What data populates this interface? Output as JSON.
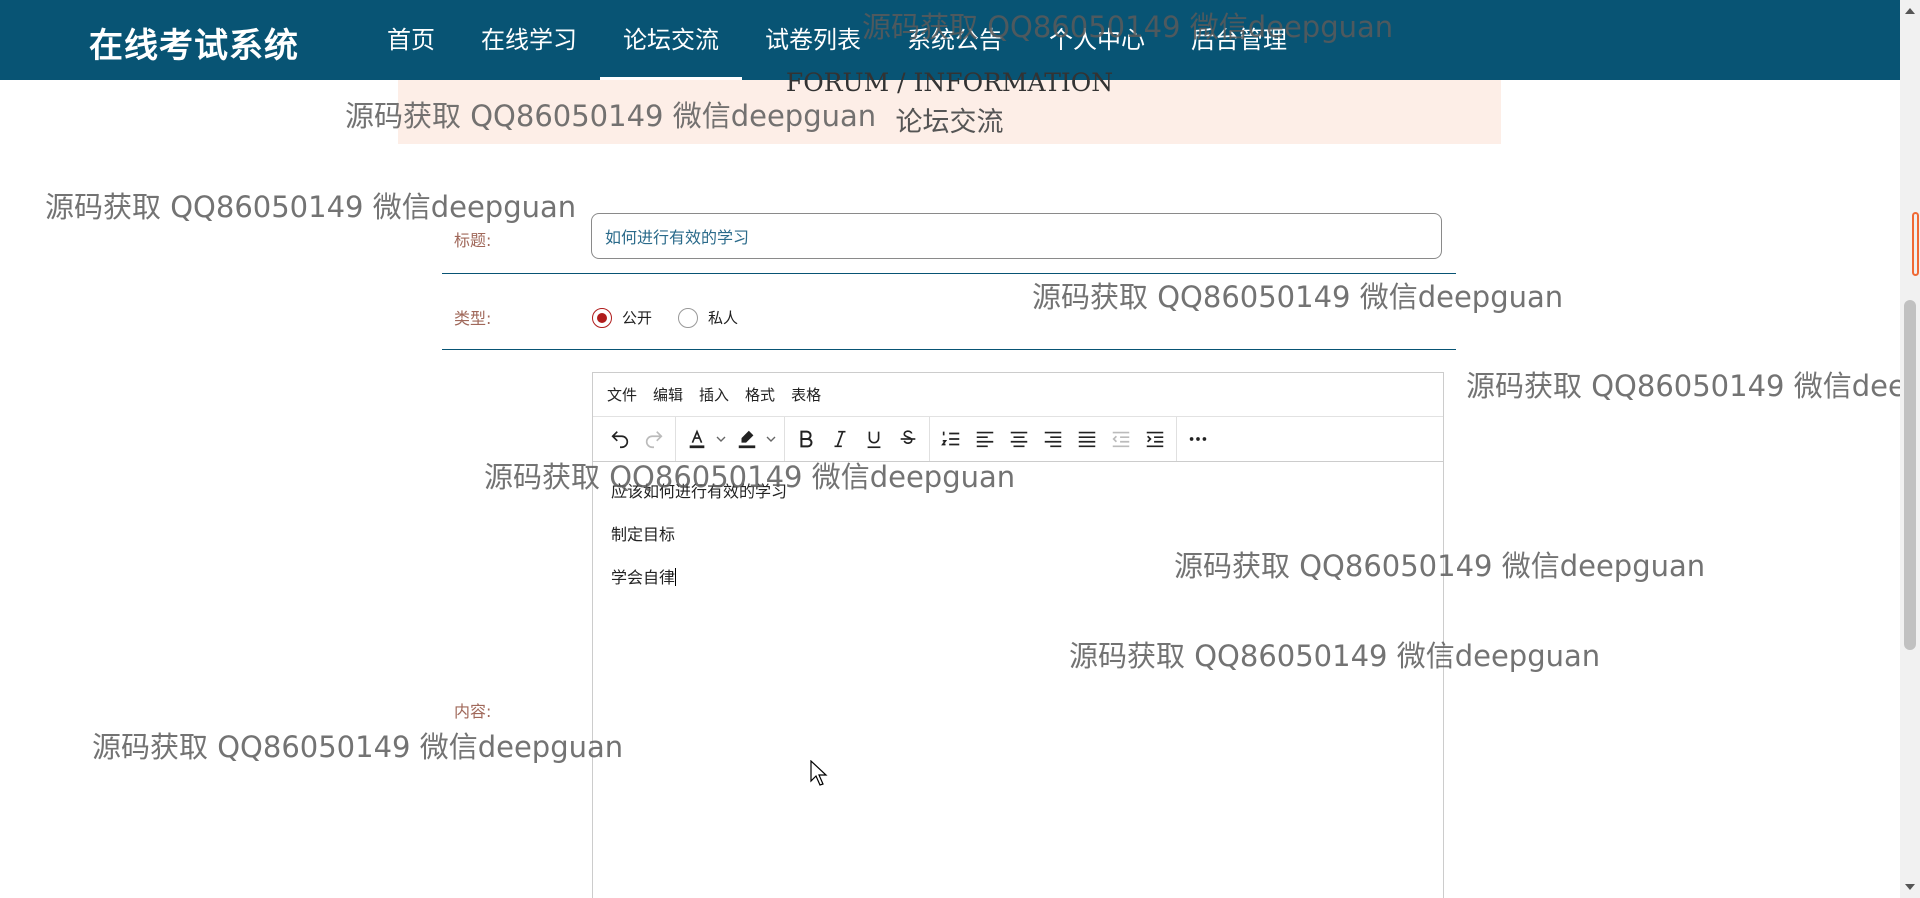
{
  "header": {
    "brand": "在线考试系统",
    "nav": [
      {
        "label": "首页"
      },
      {
        "label": "在线学习"
      },
      {
        "label": "论坛交流",
        "active": true
      },
      {
        "label": "试卷列表"
      },
      {
        "label": "系统公告"
      },
      {
        "label": "个人中心"
      },
      {
        "label": "后台管理"
      }
    ]
  },
  "banner": {
    "en": "FORUM / INFORMATION",
    "cn": "论坛交流"
  },
  "form": {
    "title_label": "标题:",
    "title_value": "如何进行有效的学习",
    "type_label": "类型:",
    "type_options": [
      {
        "label": "公开",
        "checked": true
      },
      {
        "label": "私人",
        "checked": false
      }
    ],
    "content_label": "内容:"
  },
  "editor": {
    "menu": [
      "文件",
      "编辑",
      "插入",
      "格式",
      "表格"
    ],
    "toolbar_icons": [
      "undo-icon",
      "redo-icon",
      "text-color-icon",
      "highlight-color-icon",
      "bold-icon",
      "italic-icon",
      "underline-icon",
      "strikethrough-icon",
      "numbered-list-icon",
      "align-left-icon",
      "align-center-icon",
      "align-right-icon",
      "justify-icon",
      "outdent-icon",
      "indent-icon",
      "more-icon"
    ],
    "paragraphs": [
      "应该如何进行有效的学习",
      "制定目标",
      "学会自律"
    ]
  },
  "watermark": "源码获取 QQ86050149 微信deepguan",
  "colors": {
    "header_bg": "#085474",
    "banner_bg": "#fdeee7",
    "label": "#a0685a",
    "radio_checked": "#b01c1c"
  }
}
